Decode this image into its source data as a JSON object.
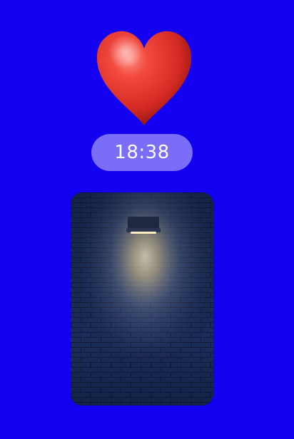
{
  "sticker": {
    "icon": "heart-icon",
    "color": "#e2322c"
  },
  "clock": {
    "time": "18:38"
  },
  "photo": {
    "subject": "brick-wall-with-lamp"
  }
}
